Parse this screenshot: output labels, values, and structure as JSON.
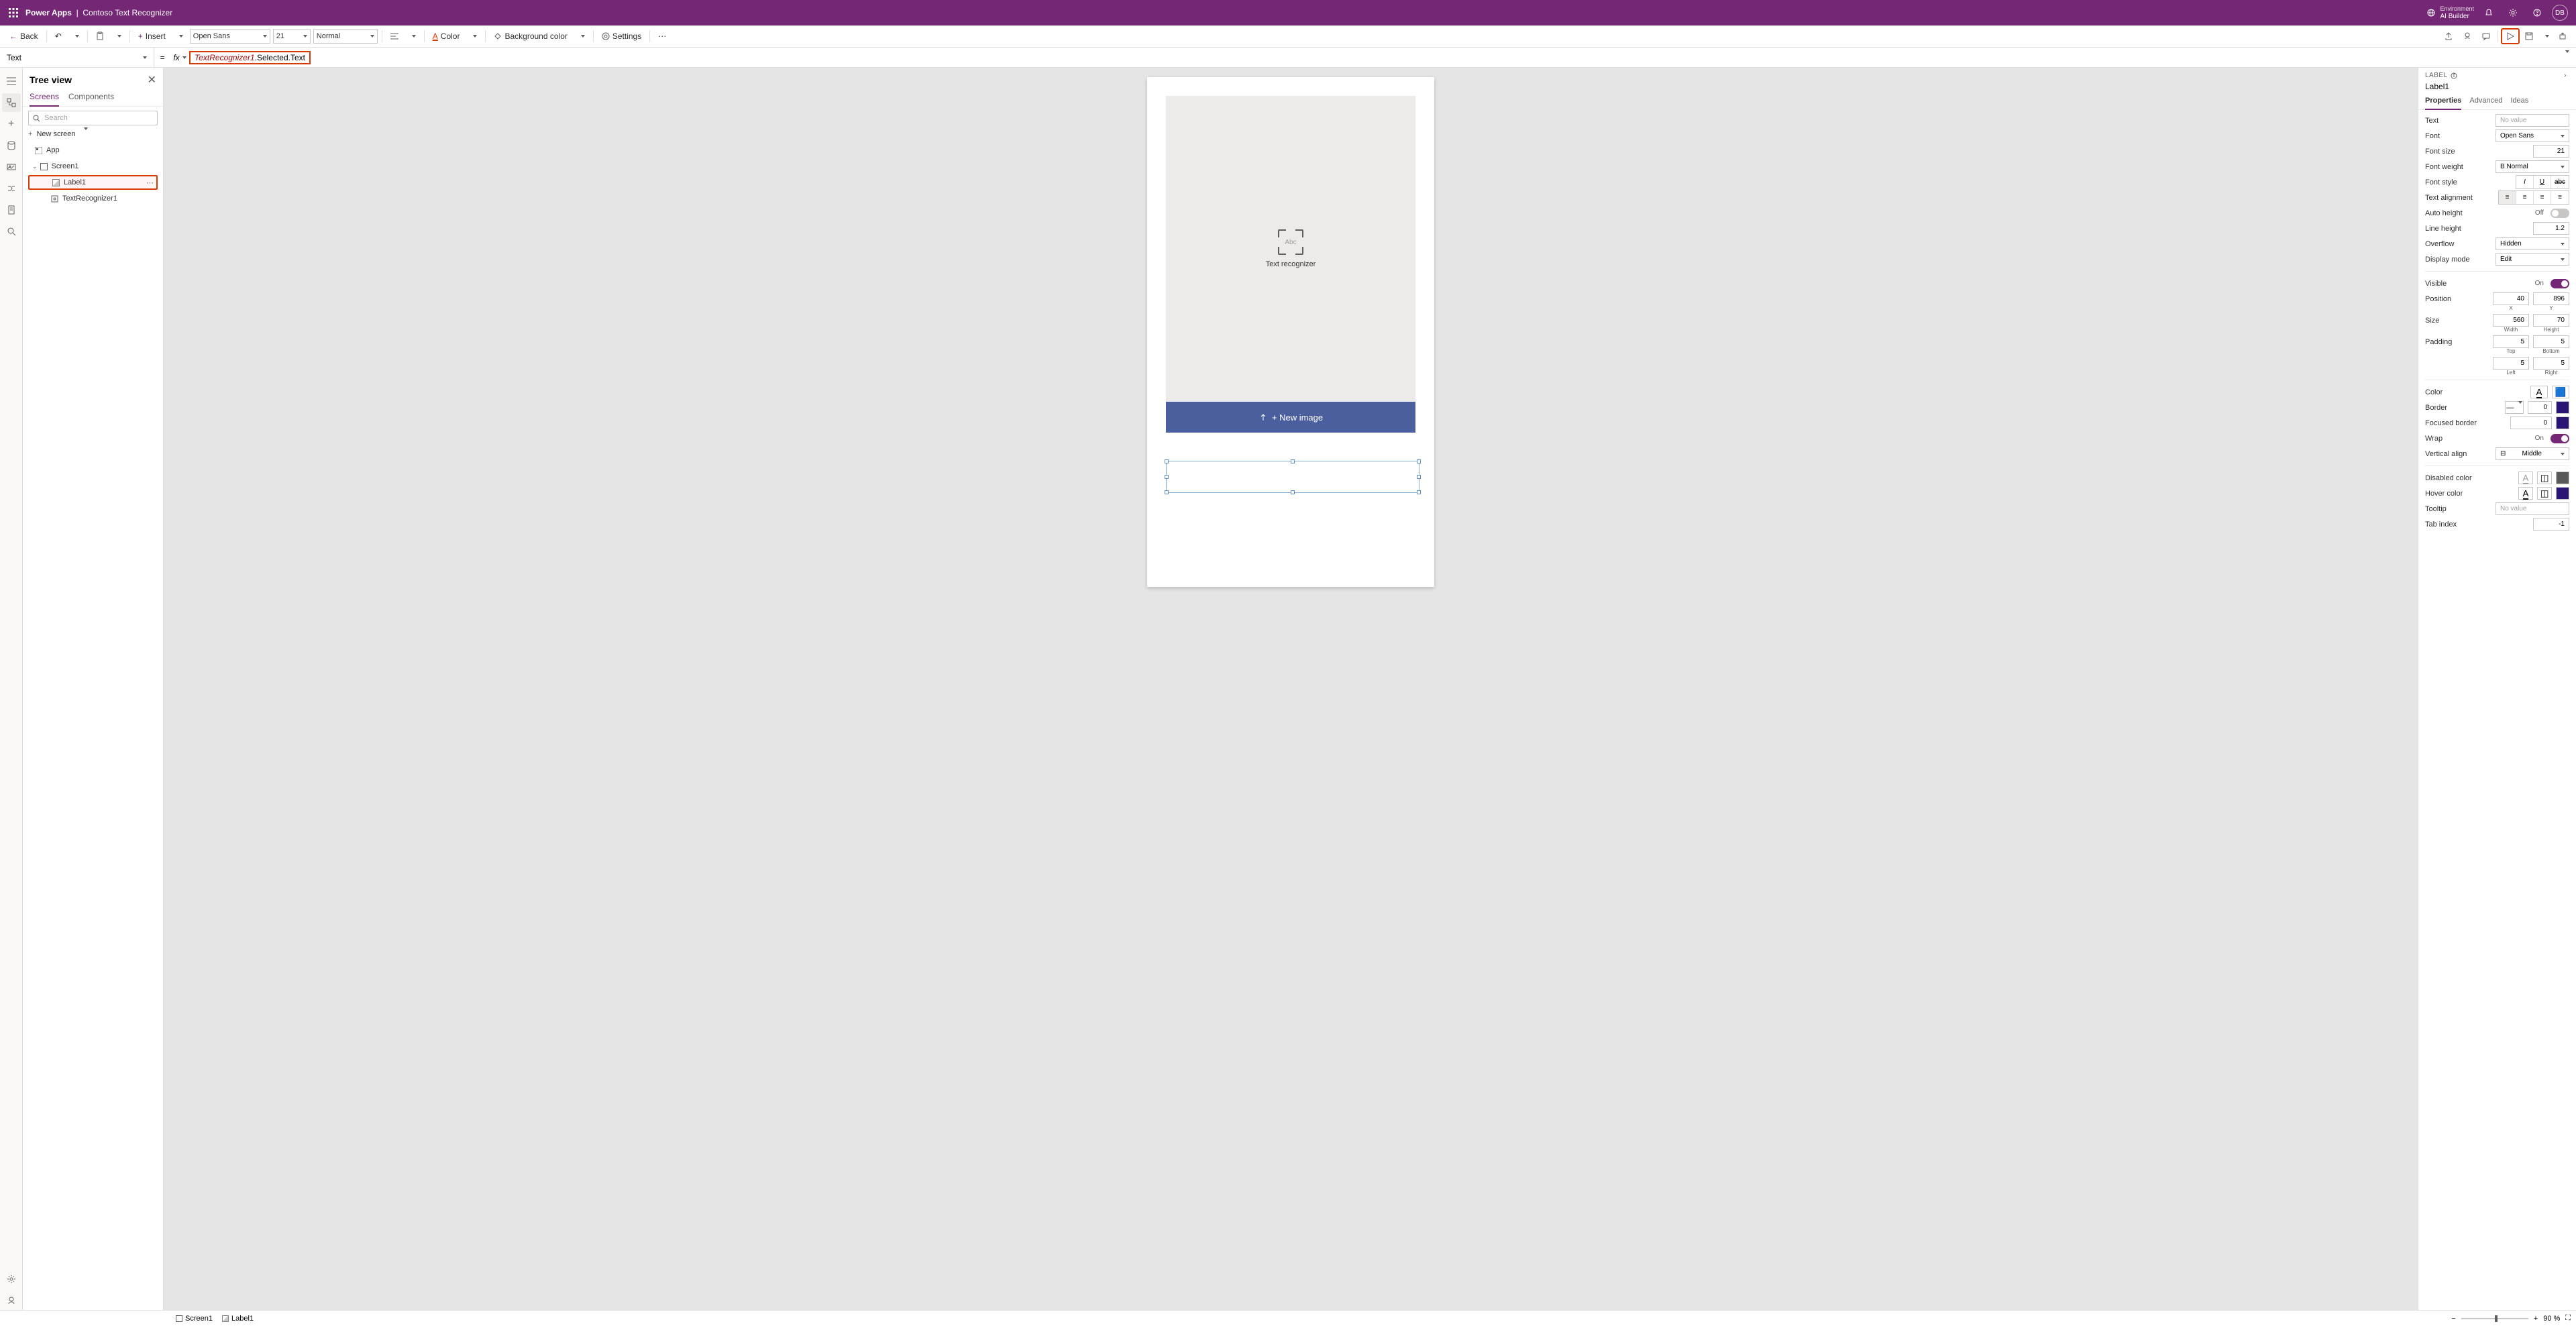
{
  "top": {
    "app": "Power Apps",
    "project": "Contoso Text Recognizer",
    "env_label": "Environment",
    "env_name": "AI Builder",
    "avatar": "DB"
  },
  "toolbar": {
    "back": "Back",
    "insert": "Insert",
    "font": "Open Sans",
    "font_size": "21",
    "font_weight": "Normal",
    "color": "Color",
    "bg_color": "Background color",
    "settings": "Settings"
  },
  "formula": {
    "property": "Text",
    "expr_obj": "TextRecognizer1",
    "expr_rest": ".Selected.Text",
    "fx": "fx"
  },
  "tree": {
    "title": "Tree view",
    "tabs": {
      "screens": "Screens",
      "components": "Components"
    },
    "search_ph": "Search",
    "new_screen": "New screen",
    "app": "App",
    "screen1": "Screen1",
    "label1": "Label1",
    "textrec": "TextRecognizer1"
  },
  "canvas": {
    "rec_label": "Text recognizer",
    "rec_abc": "Abc",
    "new_image": "+ New image"
  },
  "props": {
    "header": "LABEL",
    "name": "Label1",
    "tabs": {
      "properties": "Properties",
      "advanced": "Advanced",
      "ideas": "Ideas"
    },
    "text": {
      "label": "Text",
      "value": "No value"
    },
    "font": {
      "label": "Font",
      "value": "Open Sans"
    },
    "font_size": {
      "label": "Font size",
      "value": "21"
    },
    "font_weight": {
      "label": "Font weight",
      "value": "B  Normal"
    },
    "font_style": {
      "label": "Font style"
    },
    "text_align": {
      "label": "Text alignment"
    },
    "auto_height": {
      "label": "Auto height",
      "state": "Off"
    },
    "line_height": {
      "label": "Line height",
      "value": "1.2"
    },
    "overflow": {
      "label": "Overflow",
      "value": "Hidden"
    },
    "display_mode": {
      "label": "Display mode",
      "value": "Edit"
    },
    "visible": {
      "label": "Visible",
      "state": "On"
    },
    "position": {
      "label": "Position",
      "x": "40",
      "y": "896",
      "xl": "X",
      "yl": "Y"
    },
    "size": {
      "label": "Size",
      "w": "560",
      "h": "70",
      "wl": "Width",
      "hl": "Height"
    },
    "padding": {
      "label": "Padding",
      "t": "5",
      "b": "5",
      "l": "5",
      "r": "5",
      "tl": "Top",
      "bl": "Bottom",
      "ll": "Left",
      "rl": "Right"
    },
    "color": {
      "label": "Color"
    },
    "border": {
      "label": "Border",
      "width": "0"
    },
    "focused": {
      "label": "Focused border",
      "width": "0"
    },
    "wrap": {
      "label": "Wrap",
      "state": "On"
    },
    "valign": {
      "label": "Vertical align",
      "value": "Middle"
    },
    "disabled": {
      "label": "Disabled color"
    },
    "hover": {
      "label": "Hover color"
    },
    "tooltip": {
      "label": "Tooltip",
      "value": "No value"
    },
    "tab_index": {
      "label": "Tab index",
      "value": "-1"
    }
  },
  "status": {
    "screen": "Screen1",
    "label": "Label1",
    "zoom": "90",
    "pct": "%"
  }
}
